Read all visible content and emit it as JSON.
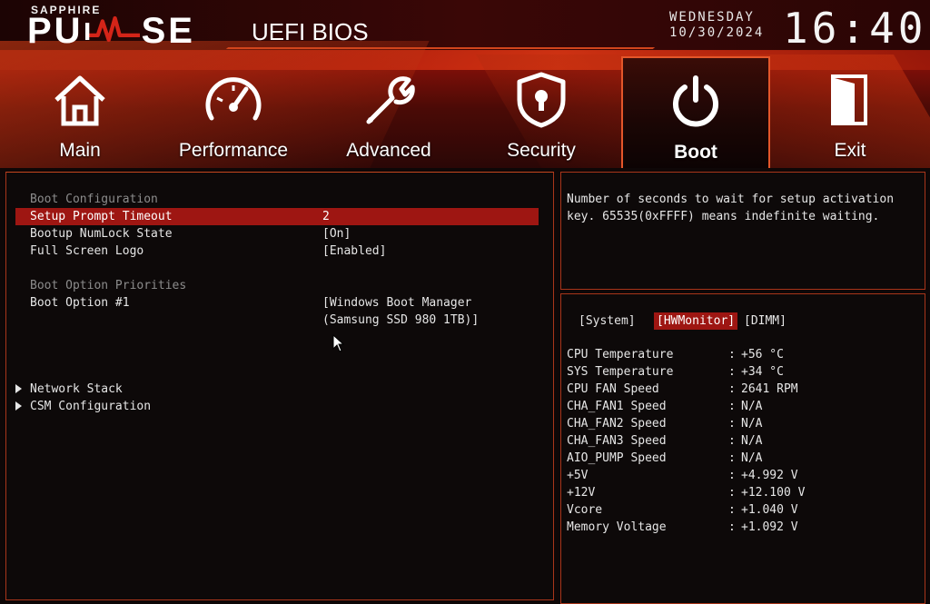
{
  "brand": {
    "sub": "SAPPHIRE",
    "main": "PU SE",
    "product": "UEFI BIOS"
  },
  "clock": {
    "day": "WEDNESDAY",
    "date": "10/30/2024",
    "time": "16:40"
  },
  "nav": {
    "tabs": [
      {
        "label": "Main",
        "icon": "house-icon"
      },
      {
        "label": "Performance",
        "icon": "speedometer-icon"
      },
      {
        "label": "Advanced",
        "icon": "wrench-icon"
      },
      {
        "label": "Security",
        "icon": "shield-lock-icon"
      },
      {
        "label": "Boot",
        "icon": "power-icon",
        "active": true
      },
      {
        "label": "Exit",
        "icon": "door-icon"
      }
    ]
  },
  "boot": {
    "boot_config_heading": "Boot Configuration",
    "setup_prompt_timeout": {
      "label": "Setup Prompt Timeout",
      "value": "2"
    },
    "numlock": {
      "label": "Bootup NumLock State",
      "value": "[On]"
    },
    "fullscreen_logo": {
      "label": "Full Screen Logo",
      "value": "[Enabled]"
    },
    "priorities_heading": "Boot Option Priorities",
    "boot_option_1": {
      "label": "Boot Option #1",
      "value_line1": "[Windows Boot Manager",
      "value_line2": "(Samsung SSD 980 1TB)]"
    },
    "network_stack": "Network Stack",
    "csm_config": "CSM Configuration"
  },
  "help": {
    "line1": "Number of seconds to wait for setup activation",
    "line2": "key. 65535(0xFFFF) means indefinite waiting."
  },
  "hw": {
    "tabs": [
      "[System]",
      "[HWMonitor]",
      "[DIMM]"
    ],
    "active_tab": "[HWMonitor]",
    "rows": [
      {
        "k": "CPU Temperature",
        "v": "+56 °C"
      },
      {
        "k": "SYS Temperature",
        "v": "+34 °C"
      },
      {
        "k": "CPU FAN Speed",
        "v": "2641 RPM"
      },
      {
        "k": "CHA_FAN1 Speed",
        "v": "N/A"
      },
      {
        "k": "CHA_FAN2 Speed",
        "v": "N/A"
      },
      {
        "k": "CHA_FAN3 Speed",
        "v": "N/A"
      },
      {
        "k": "AIO_PUMP Speed",
        "v": "N/A"
      },
      {
        "k": "+5V",
        "v": "+4.992 V"
      },
      {
        "k": "+12V",
        "v": "+12.100 V"
      },
      {
        "k": "Vcore",
        "v": "+1.040 V"
      },
      {
        "k": "Memory Voltage",
        "v": "+1.092 V"
      }
    ],
    "separator": ":"
  },
  "colors": {
    "accent": "#9e1612",
    "border": "#c6461e",
    "background": "#0d0909"
  }
}
